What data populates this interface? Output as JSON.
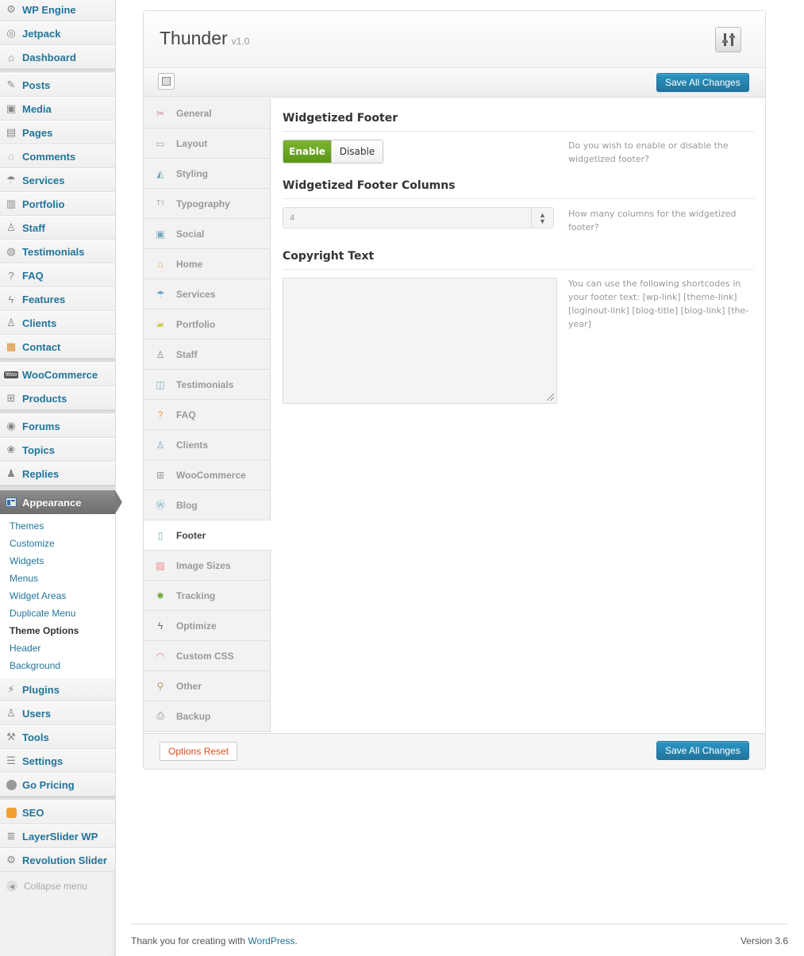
{
  "sidebar": {
    "items": [
      {
        "label": "WP Engine",
        "icon": "gear-icon"
      },
      {
        "label": "Jetpack",
        "icon": "jetpack-icon"
      },
      {
        "label": "Dashboard",
        "icon": "dashboard-icon"
      },
      {
        "label": "Posts",
        "icon": "pin-icon"
      },
      {
        "label": "Media",
        "icon": "media-icon"
      },
      {
        "label": "Pages",
        "icon": "pages-icon"
      },
      {
        "label": "Comments",
        "icon": "comment-icon"
      },
      {
        "label": "Services",
        "icon": "umbrella-icon"
      },
      {
        "label": "Portfolio",
        "icon": "portfolio-icon"
      },
      {
        "label": "Staff",
        "icon": "person-icon"
      },
      {
        "label": "Testimonials",
        "icon": "chat-icon"
      },
      {
        "label": "FAQ",
        "icon": "question-icon"
      },
      {
        "label": "Features",
        "icon": "lightning-icon"
      },
      {
        "label": "Clients",
        "icon": "clients-icon"
      },
      {
        "label": "Contact",
        "icon": "contact-icon"
      },
      {
        "label": "WooCommerce",
        "icon": "woo-icon"
      },
      {
        "label": "Products",
        "icon": "cart-icon"
      },
      {
        "label": "Forums",
        "icon": "forums-icon"
      },
      {
        "label": "Topics",
        "icon": "topics-icon"
      },
      {
        "label": "Replies",
        "icon": "replies-icon"
      },
      {
        "label": "Appearance",
        "icon": "appearance-icon"
      },
      {
        "label": "Plugins",
        "icon": "plug-icon"
      },
      {
        "label": "Users",
        "icon": "users-icon"
      },
      {
        "label": "Tools",
        "icon": "tools-icon"
      },
      {
        "label": "Settings",
        "icon": "settings-icon"
      },
      {
        "label": "Go Pricing",
        "icon": "pricing-icon"
      },
      {
        "label": "SEO",
        "icon": "seo-icon"
      },
      {
        "label": "LayerSlider WP",
        "icon": "layers-icon"
      },
      {
        "label": "Revolution Slider",
        "icon": "slider-gear-icon"
      }
    ],
    "submenu": [
      "Themes",
      "Customize",
      "Widgets",
      "Menus",
      "Widget Areas",
      "Duplicate Menu",
      "Theme Options",
      "Header",
      "Background"
    ],
    "current_submenu": "Theme Options",
    "collapse_label": "Collapse menu"
  },
  "panel": {
    "theme_name": "Thunder",
    "theme_version": "v1.0",
    "save_label": "Save All Changes",
    "reset_label": "Options Reset",
    "tabs": [
      "General",
      "Layout",
      "Styling",
      "Typography",
      "Social",
      "Home",
      "Services",
      "Portfolio",
      "Staff",
      "Testimonials",
      "FAQ",
      "Clients",
      "WooCommerce",
      "Blog",
      "Footer",
      "Image Sizes",
      "Tracking",
      "Optimize",
      "Custom CSS",
      "Other",
      "Backup"
    ],
    "active_tab": "Footer",
    "sections": {
      "footer_title": "Widgetized Footer",
      "enable_label": "Enable",
      "disable_label": "Disable",
      "footer_desc": "Do you wish to enable or disable the widgetized footer?",
      "columns_title": "Widgetized Footer Columns",
      "columns_value": "4",
      "columns_desc": "How many columns for the widgetized footer?",
      "copyright_title": "Copyright Text",
      "copyright_desc": "You can use the following shortcodes in your footer text: [wp-link] [theme-link] [loginout-link] [blog-title] [blog-link] [the-year]"
    }
  },
  "footer": {
    "thanks_prefix": "Thank you for creating with ",
    "wp_link": "WordPress",
    "thanks_suffix": ".",
    "version": "Version 3.6"
  },
  "colors": {
    "link": "#21759b",
    "save_button": "#21759b",
    "enable_green": "#6aa524",
    "reset_text": "#e04e1b"
  }
}
